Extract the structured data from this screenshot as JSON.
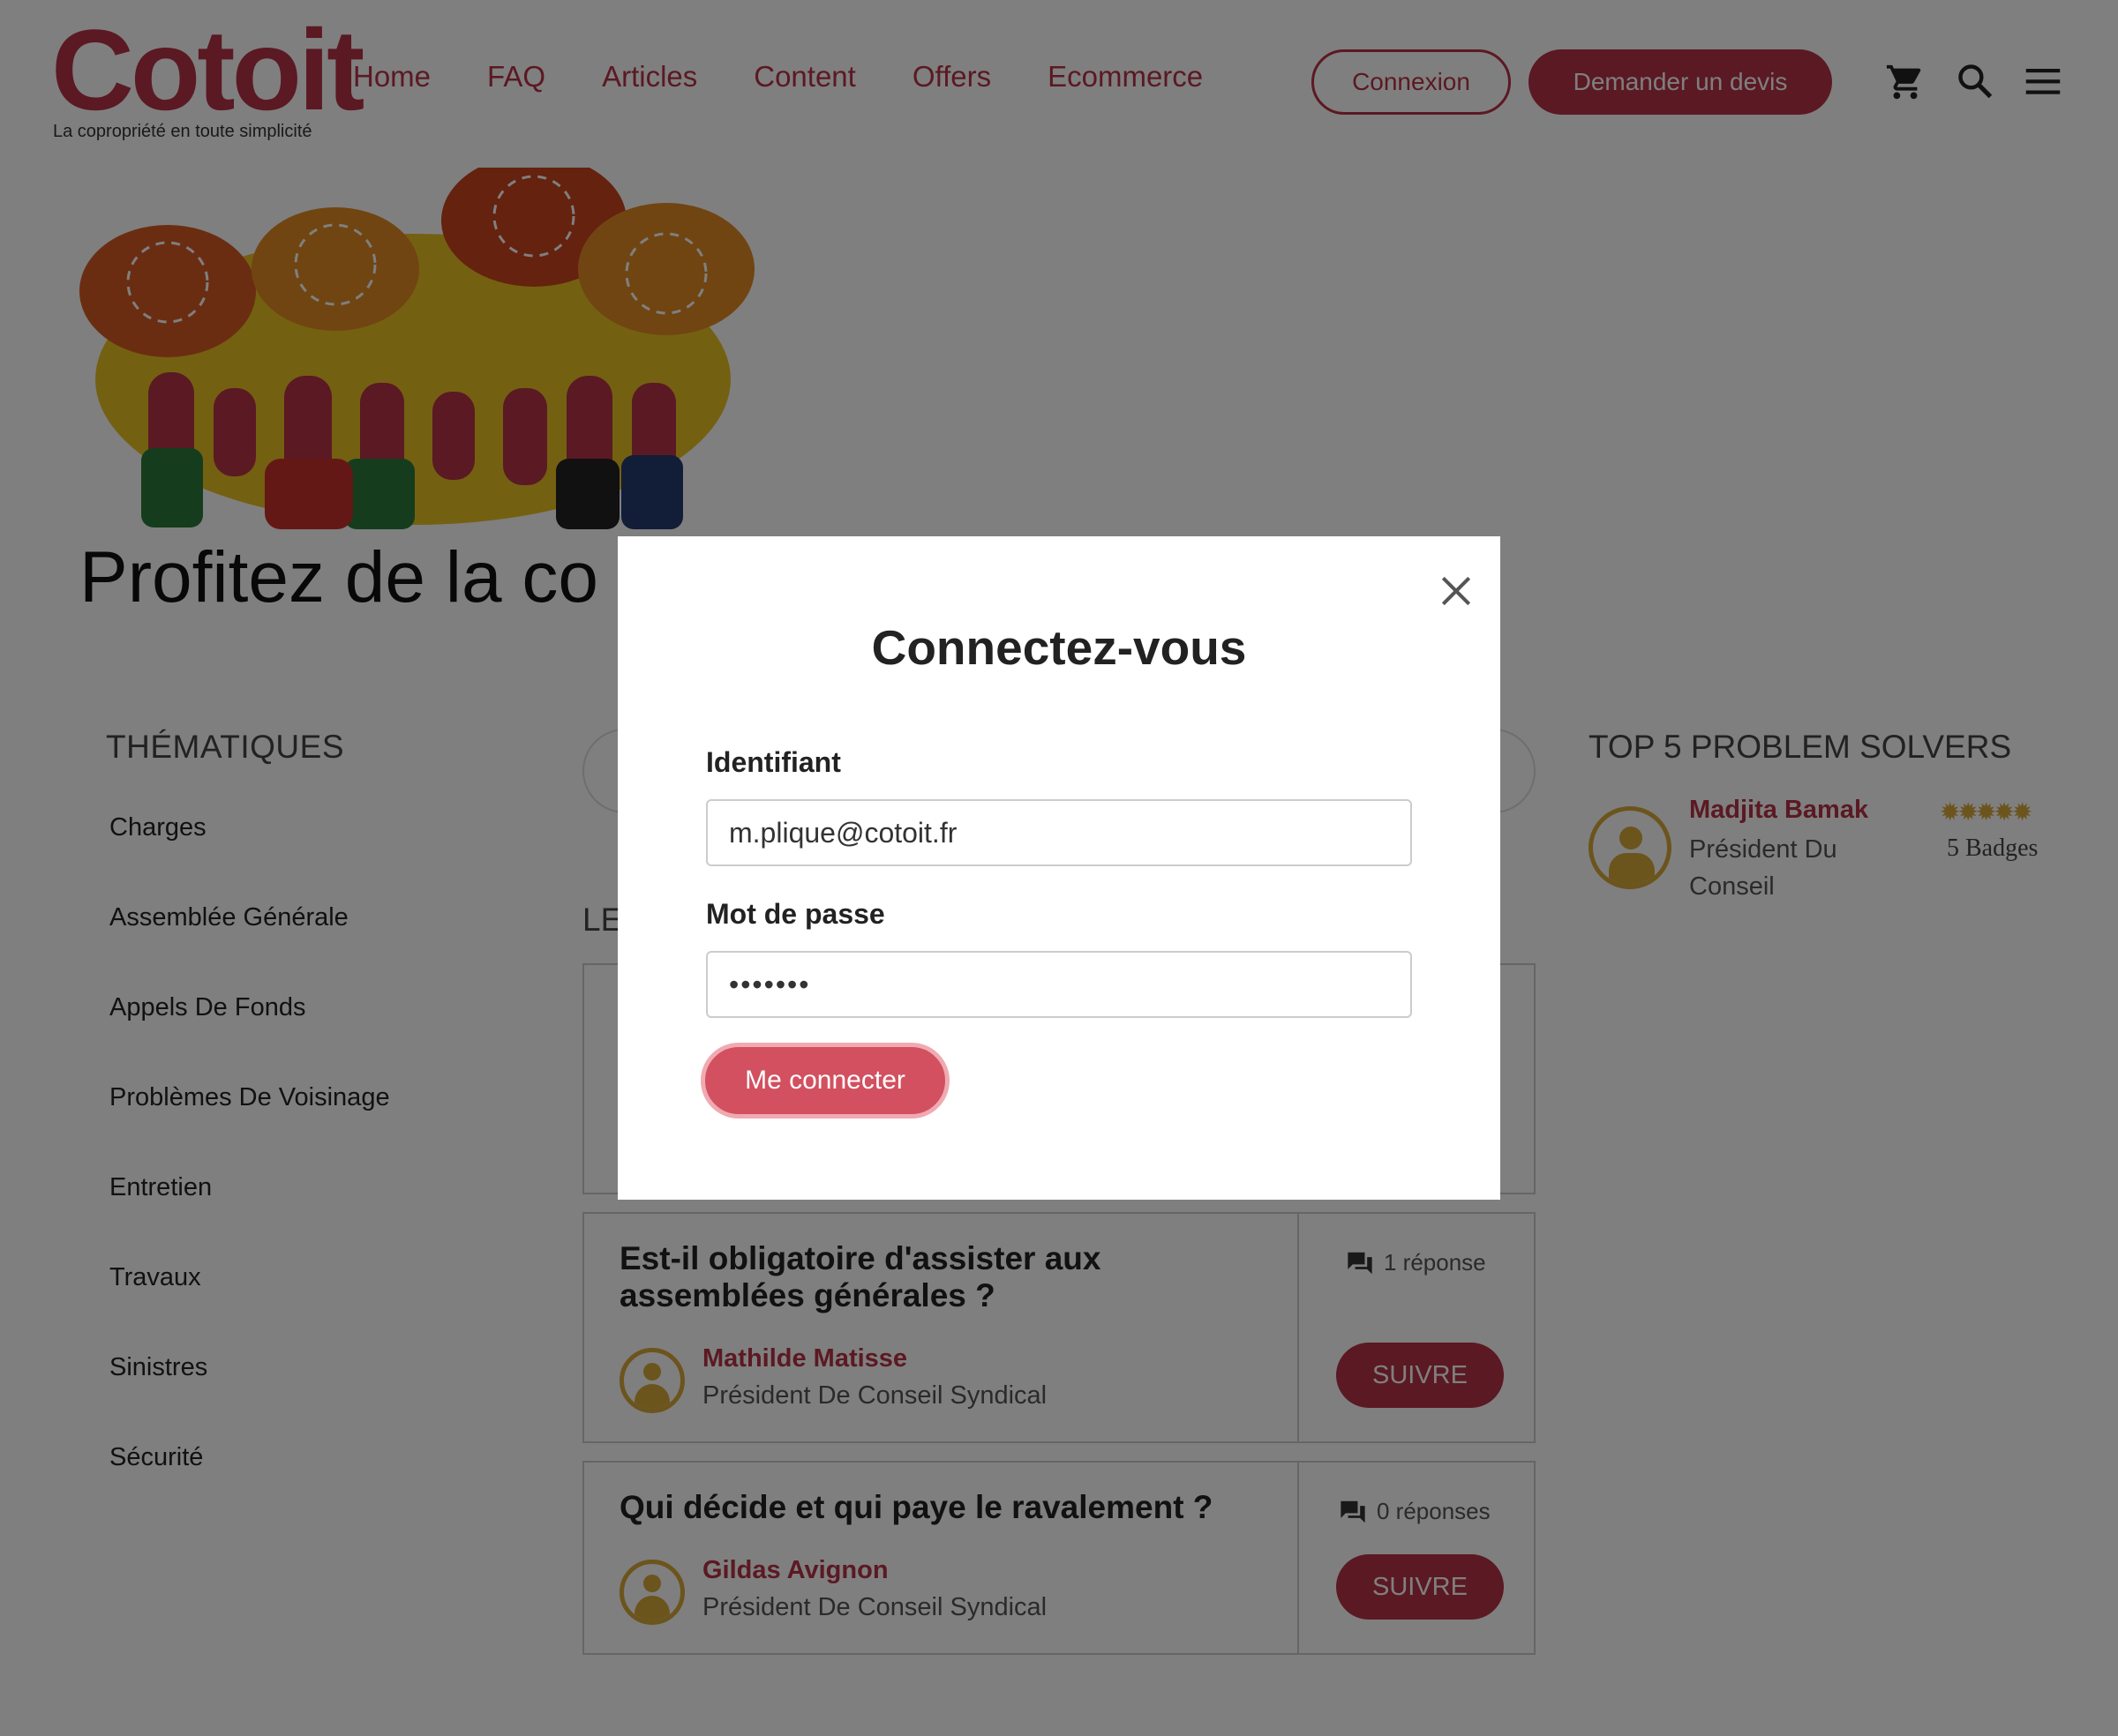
{
  "brand": {
    "logo_text": "Cotoit",
    "tagline": "La copropriété en toute simplicité",
    "accent_color": "#b73246"
  },
  "nav": {
    "items": [
      {
        "label": "Home"
      },
      {
        "label": "FAQ"
      },
      {
        "label": "Articles"
      },
      {
        "label": "Content"
      },
      {
        "label": "Offers"
      },
      {
        "label": "Ecommerce"
      }
    ]
  },
  "header_actions": {
    "login_label": "Connexion",
    "quote_label": "Demander un devis",
    "icons": [
      "cart-icon",
      "search-icon",
      "menu-icon"
    ]
  },
  "hero": {
    "title": "Profitez de la co                                                         uestions"
  },
  "sidebar": {
    "heading": "THÉMATIQUES",
    "items": [
      {
        "label": "Charges"
      },
      {
        "label": "Assemblée Générale"
      },
      {
        "label": "Appels De Fonds"
      },
      {
        "label": "Problèmes De Voisinage"
      },
      {
        "label": "Entretien"
      },
      {
        "label": "Travaux"
      },
      {
        "label": "Sinistres"
      },
      {
        "label": "Sécurité"
      }
    ]
  },
  "center": {
    "partial_heading": "LE",
    "questions": [
      {
        "title": "Est-il obligatoire d'assister aux assemblées générales ?",
        "author": "Mathilde Matisse",
        "role": "Président De Conseil Syndical",
        "replies": "1 réponse",
        "follow_label": "SUIVRE"
      },
      {
        "title": "Qui décide et qui paye le ravalement ?",
        "author": "Gildas Avignon",
        "role": "Président De Conseil Syndical",
        "replies": "0 réponses",
        "follow_label": "SUIVRE"
      }
    ]
  },
  "top_solvers": {
    "heading": "TOP 5 PROBLEM SOLVERS",
    "items": [
      {
        "name": "Madjita Bamak",
        "role": "Président Du Conseil",
        "badges": "5 Badges",
        "stars": 5
      }
    ]
  },
  "modal": {
    "title": "Connectez-vous",
    "username_label": "Identifiant",
    "username_value": "m.plique@cotoit.fr",
    "password_label": "Mot de passe",
    "password_value": "•••••••",
    "submit_label": "Me connecter"
  }
}
